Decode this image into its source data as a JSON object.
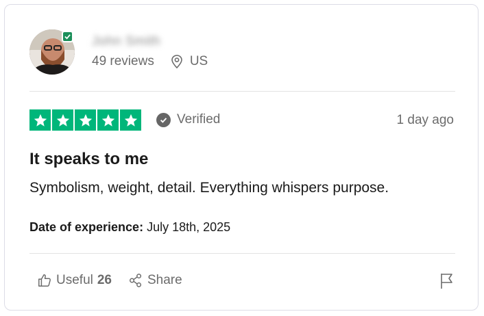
{
  "reviewer": {
    "name": "John Smith",
    "reviews_count": "49 reviews",
    "country": "US"
  },
  "review": {
    "rating": 5,
    "verified_label": "Verified",
    "date_ago": "1 day ago",
    "title": "It speaks to me",
    "body": "Symbolism, weight, detail. Everything whispers purpose.",
    "experience_label": "Date of experience:",
    "experience_date": "July 18th, 2025"
  },
  "actions": {
    "useful_label": "Useful",
    "useful_count": "26",
    "share_label": "Share"
  },
  "colors": {
    "star_green": "#00b67a",
    "badge_green": "#1c8f5a",
    "muted_text": "#6b6b6b"
  }
}
